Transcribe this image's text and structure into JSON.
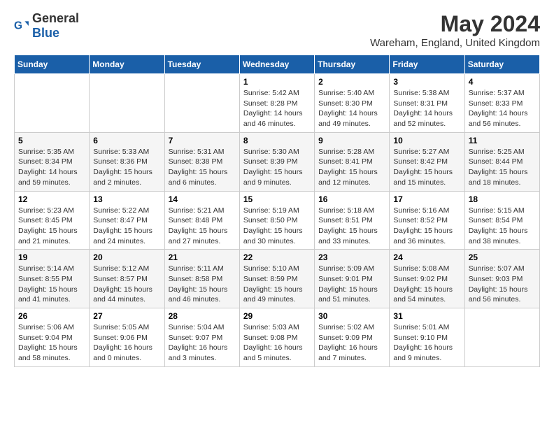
{
  "logo": {
    "text_general": "General",
    "text_blue": "Blue"
  },
  "title": "May 2024",
  "subtitle": "Wareham, England, United Kingdom",
  "days_of_week": [
    "Sunday",
    "Monday",
    "Tuesday",
    "Wednesday",
    "Thursday",
    "Friday",
    "Saturday"
  ],
  "weeks": [
    [
      {
        "day": "",
        "info": ""
      },
      {
        "day": "",
        "info": ""
      },
      {
        "day": "",
        "info": ""
      },
      {
        "day": "1",
        "info": "Sunrise: 5:42 AM\nSunset: 8:28 PM\nDaylight: 14 hours\nand 46 minutes."
      },
      {
        "day": "2",
        "info": "Sunrise: 5:40 AM\nSunset: 8:30 PM\nDaylight: 14 hours\nand 49 minutes."
      },
      {
        "day": "3",
        "info": "Sunrise: 5:38 AM\nSunset: 8:31 PM\nDaylight: 14 hours\nand 52 minutes."
      },
      {
        "day": "4",
        "info": "Sunrise: 5:37 AM\nSunset: 8:33 PM\nDaylight: 14 hours\nand 56 minutes."
      }
    ],
    [
      {
        "day": "5",
        "info": "Sunrise: 5:35 AM\nSunset: 8:34 PM\nDaylight: 14 hours\nand 59 minutes."
      },
      {
        "day": "6",
        "info": "Sunrise: 5:33 AM\nSunset: 8:36 PM\nDaylight: 15 hours\nand 2 minutes."
      },
      {
        "day": "7",
        "info": "Sunrise: 5:31 AM\nSunset: 8:38 PM\nDaylight: 15 hours\nand 6 minutes."
      },
      {
        "day": "8",
        "info": "Sunrise: 5:30 AM\nSunset: 8:39 PM\nDaylight: 15 hours\nand 9 minutes."
      },
      {
        "day": "9",
        "info": "Sunrise: 5:28 AM\nSunset: 8:41 PM\nDaylight: 15 hours\nand 12 minutes."
      },
      {
        "day": "10",
        "info": "Sunrise: 5:27 AM\nSunset: 8:42 PM\nDaylight: 15 hours\nand 15 minutes."
      },
      {
        "day": "11",
        "info": "Sunrise: 5:25 AM\nSunset: 8:44 PM\nDaylight: 15 hours\nand 18 minutes."
      }
    ],
    [
      {
        "day": "12",
        "info": "Sunrise: 5:23 AM\nSunset: 8:45 PM\nDaylight: 15 hours\nand 21 minutes."
      },
      {
        "day": "13",
        "info": "Sunrise: 5:22 AM\nSunset: 8:47 PM\nDaylight: 15 hours\nand 24 minutes."
      },
      {
        "day": "14",
        "info": "Sunrise: 5:21 AM\nSunset: 8:48 PM\nDaylight: 15 hours\nand 27 minutes."
      },
      {
        "day": "15",
        "info": "Sunrise: 5:19 AM\nSunset: 8:50 PM\nDaylight: 15 hours\nand 30 minutes."
      },
      {
        "day": "16",
        "info": "Sunrise: 5:18 AM\nSunset: 8:51 PM\nDaylight: 15 hours\nand 33 minutes."
      },
      {
        "day": "17",
        "info": "Sunrise: 5:16 AM\nSunset: 8:52 PM\nDaylight: 15 hours\nand 36 minutes."
      },
      {
        "day": "18",
        "info": "Sunrise: 5:15 AM\nSunset: 8:54 PM\nDaylight: 15 hours\nand 38 minutes."
      }
    ],
    [
      {
        "day": "19",
        "info": "Sunrise: 5:14 AM\nSunset: 8:55 PM\nDaylight: 15 hours\nand 41 minutes."
      },
      {
        "day": "20",
        "info": "Sunrise: 5:12 AM\nSunset: 8:57 PM\nDaylight: 15 hours\nand 44 minutes."
      },
      {
        "day": "21",
        "info": "Sunrise: 5:11 AM\nSunset: 8:58 PM\nDaylight: 15 hours\nand 46 minutes."
      },
      {
        "day": "22",
        "info": "Sunrise: 5:10 AM\nSunset: 8:59 PM\nDaylight: 15 hours\nand 49 minutes."
      },
      {
        "day": "23",
        "info": "Sunrise: 5:09 AM\nSunset: 9:01 PM\nDaylight: 15 hours\nand 51 minutes."
      },
      {
        "day": "24",
        "info": "Sunrise: 5:08 AM\nSunset: 9:02 PM\nDaylight: 15 hours\nand 54 minutes."
      },
      {
        "day": "25",
        "info": "Sunrise: 5:07 AM\nSunset: 9:03 PM\nDaylight: 15 hours\nand 56 minutes."
      }
    ],
    [
      {
        "day": "26",
        "info": "Sunrise: 5:06 AM\nSunset: 9:04 PM\nDaylight: 15 hours\nand 58 minutes."
      },
      {
        "day": "27",
        "info": "Sunrise: 5:05 AM\nSunset: 9:06 PM\nDaylight: 16 hours\nand 0 minutes."
      },
      {
        "day": "28",
        "info": "Sunrise: 5:04 AM\nSunset: 9:07 PM\nDaylight: 16 hours\nand 3 minutes."
      },
      {
        "day": "29",
        "info": "Sunrise: 5:03 AM\nSunset: 9:08 PM\nDaylight: 16 hours\nand 5 minutes."
      },
      {
        "day": "30",
        "info": "Sunrise: 5:02 AM\nSunset: 9:09 PM\nDaylight: 16 hours\nand 7 minutes."
      },
      {
        "day": "31",
        "info": "Sunrise: 5:01 AM\nSunset: 9:10 PM\nDaylight: 16 hours\nand 9 minutes."
      },
      {
        "day": "",
        "info": ""
      }
    ]
  ]
}
